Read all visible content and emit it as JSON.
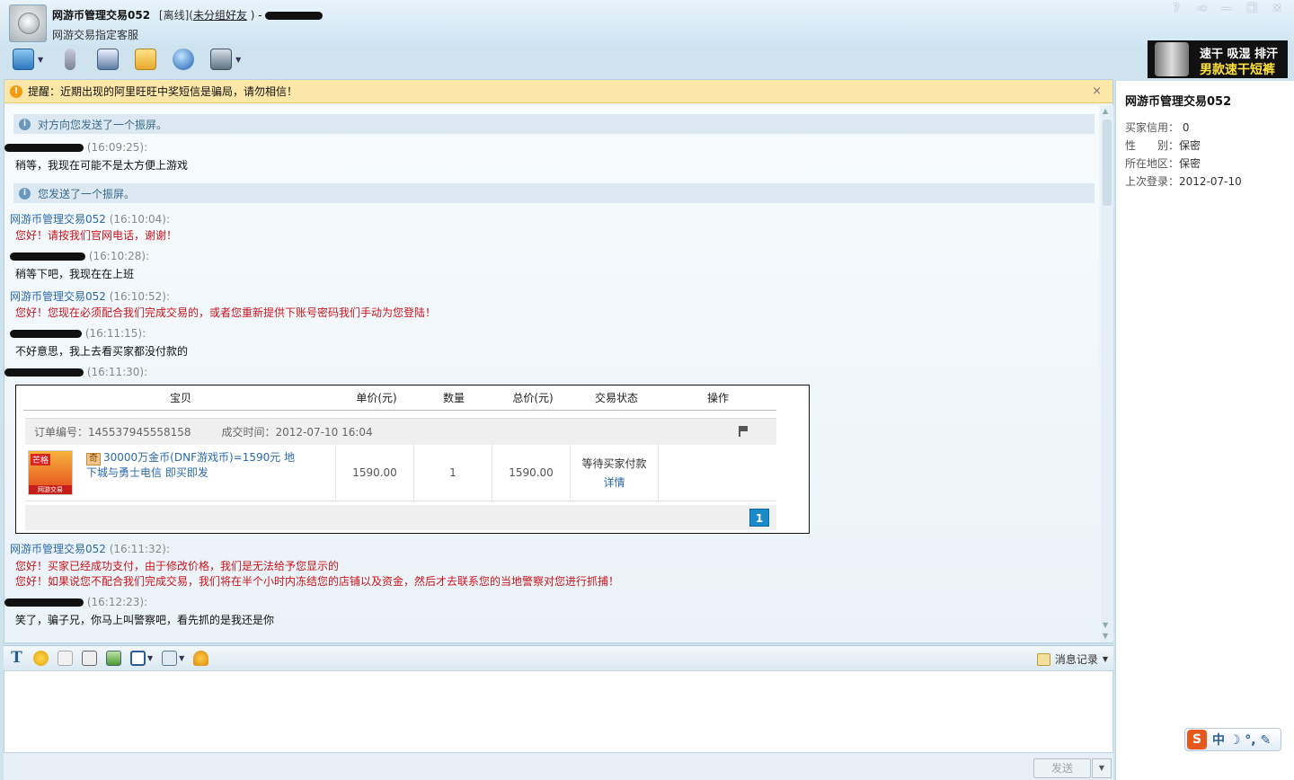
{
  "window": {
    "contact_name": "网游币管理交易052",
    "status": "[离线](",
    "group": "未分组好友",
    "close_paren": ")",
    "dash": "-",
    "subtitle": "网游交易指定客服",
    "buttons": [
      "?",
      "⇥",
      "—",
      "❐",
      "✕"
    ]
  },
  "toolbar": {
    "icons": [
      "file-transfer-icon",
      "voice-icon",
      "video-icon",
      "message-icon",
      "web-icon",
      "contact-info-icon"
    ]
  },
  "ad": {
    "line1": "速干 吸湿 排汗",
    "line2": "男款速干短裤"
  },
  "notice": {
    "text": "提醒：近期出现的阿里旺旺中奖短信是骗局，请勿相信！",
    "close": "×"
  },
  "messages": {
    "sys1": "对方向您发送了一个振屏。",
    "m1_time": "(16:09:25):",
    "m1_text": "稍等，我现在可能不是太方便上游戏",
    "sys2": "您发送了一个振屏。",
    "m2_sender": "网游币管理交易052",
    "m2_time": "(16:10:04):",
    "m2_text": "您好！请按我们官网电话，谢谢！",
    "m3_time": "(16:10:28):",
    "m3_text": "稍等下吧，我现在在上班",
    "m4_sender": "网游币管理交易052",
    "m4_time": "(16:10:52):",
    "m4_text": "您好！您现在必须配合我们完成交易的，或者您重新提供下账号密码我们手动为您登陆！",
    "m5_time": "(16:11:15):",
    "m5_text": "不好意思，我上去看买家都没付款的",
    "m6_time": "(16:11:30):",
    "m7_sender": "网游币管理交易052",
    "m7_time": "(16:11:32):",
    "m7_text1": "您好！买家已经成功支付，由于修改价格，我们是无法给予您显示的",
    "m7_text2": "您好！如果说您不配合我们完成交易，我们将在半个小时内冻结您的店铺以及资金，然后才去联系您的当地警察对您进行抓捕！",
    "m8_time": "(16:12:23):",
    "m8_text": "笑了，骗子兄，你马上叫警察吧，看先抓的是我还是你"
  },
  "order": {
    "headers": [
      "宝贝",
      "单价(元)",
      "数量",
      "总价(元)",
      "交易状态",
      "操作"
    ],
    "order_no": "订单编号：145537945558158",
    "deal_time": "成交时间：2012-07-10 16:04",
    "item_badge": "奇",
    "item_title": "30000万金币(DNF游戏币)=1590元 地下城与勇士电信 即买即发",
    "img_tag": "芒格",
    "img_foot": "网游交易",
    "price": "1590.00",
    "qty": "1",
    "total": "1590.00",
    "status": "等待买家付款",
    "detail": "详情",
    "page": "1"
  },
  "input_toolbar": {
    "history": "消息记录"
  },
  "send": {
    "label": "发送",
    "caret": "▼"
  },
  "profile": {
    "name": "网游币管理交易052",
    "credit_label": "买家信用：",
    "credit_value": "0",
    "gender_label": "性　　别：",
    "gender_value": "保密",
    "region_label": "所在地区：",
    "region_value": "保密",
    "last_login_label": "上次登录：",
    "last_login_value": "2012-07-10"
  },
  "ime": {
    "logo": "S",
    "text": "中 ☽ °, ✎"
  }
}
